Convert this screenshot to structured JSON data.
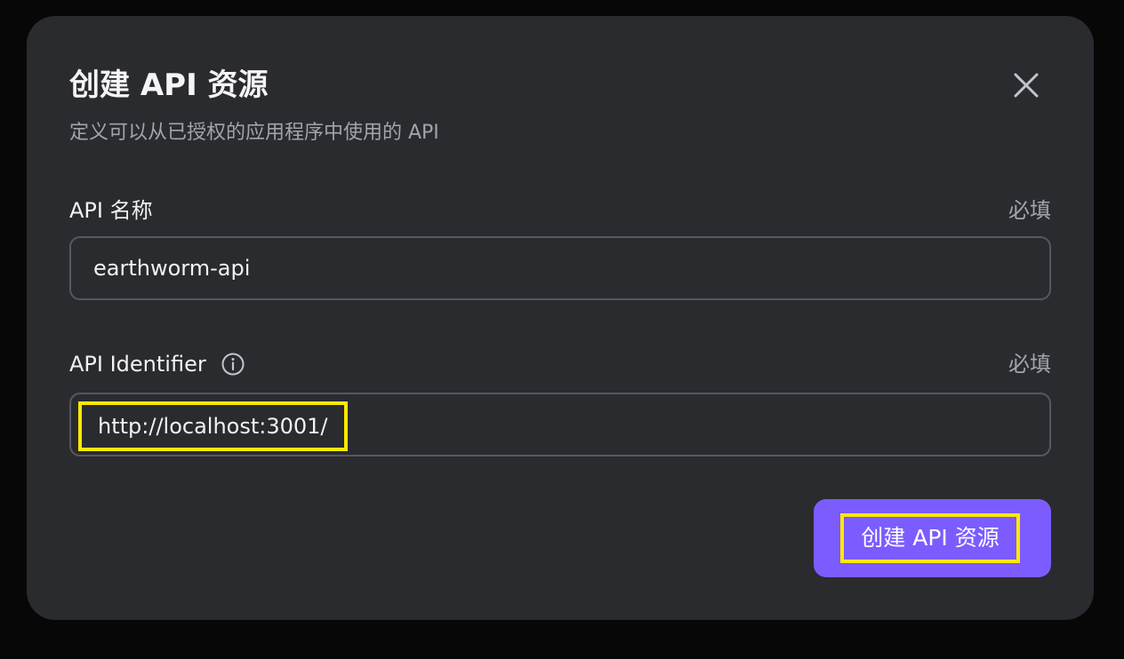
{
  "dialog": {
    "title": "创建 API 资源",
    "subtitle": "定义可以从已授权的应用程序中使用的 API",
    "close_icon": "close-icon"
  },
  "fields": {
    "name": {
      "label": "API 名称",
      "required": "必填",
      "value": "earthworm-api"
    },
    "identifier": {
      "label": "API Identifier",
      "info_icon": "info-icon",
      "required": "必填",
      "value": "http://localhost:3001/"
    }
  },
  "actions": {
    "submit_label": "创建 API 资源"
  },
  "colors": {
    "page_background": "#070707",
    "dialog_background": "#2a2b2f",
    "primary": "#7c5cff",
    "highlight": "#ffe800",
    "muted_text": "#a3a4aa",
    "input_border": "#57585e"
  }
}
